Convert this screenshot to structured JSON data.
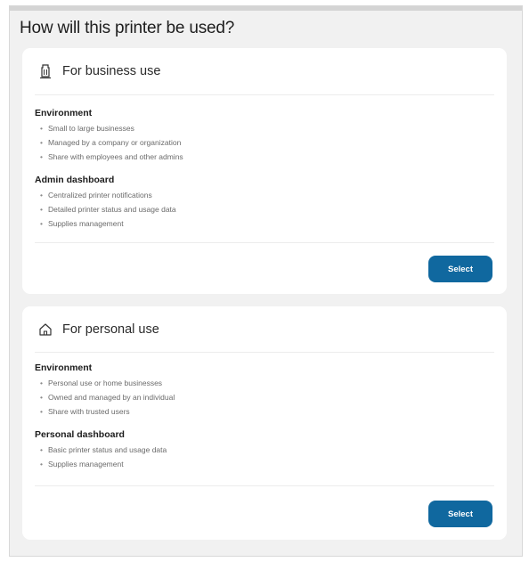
{
  "page": {
    "title": "How will this printer be used?"
  },
  "business": {
    "icon": "building-icon",
    "title": "For business use",
    "sections": [
      {
        "heading": "Environment",
        "items": [
          "Small to large businesses",
          "Managed by a company or organization",
          "Share with employees and other admins"
        ]
      },
      {
        "heading": "Admin dashboard",
        "items": [
          "Centralized printer notifications",
          "Detailed printer status and usage data",
          "Supplies management"
        ]
      }
    ],
    "select_label": "Select"
  },
  "personal": {
    "icon": "home-icon",
    "title": "For personal use",
    "sections": [
      {
        "heading": "Environment",
        "items": [
          "Personal use or home businesses",
          "Owned and managed by an individual",
          "Share with trusted users"
        ]
      },
      {
        "heading": "Personal dashboard",
        "items": [
          "Basic printer status and usage data",
          "Supplies management"
        ]
      }
    ],
    "select_label": "Select"
  },
  "colors": {
    "accent": "#10689f",
    "background": "#f1f1f1",
    "card": "#ffffff"
  }
}
